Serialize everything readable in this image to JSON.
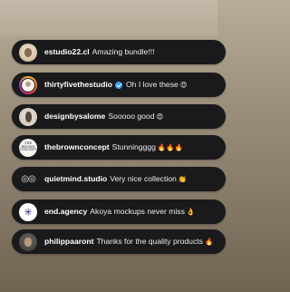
{
  "comments": [
    {
      "user": "estudio22.cl",
      "verified": false,
      "message": "Amazing bundle!!!",
      "emoji": "",
      "avatar_icon": "portrait-avatar"
    },
    {
      "user": "thirtyfivethestudio",
      "verified": true,
      "message": "Oh I love these",
      "emoji": "😍",
      "avatar_icon": "star-logo-avatar"
    },
    {
      "user": "designbysalome",
      "verified": false,
      "message": "Sooooo good",
      "emoji": "😍",
      "avatar_icon": "portrait-avatar"
    },
    {
      "user": "thebrownconcept",
      "verified": false,
      "message": "Stunningggg",
      "emoji": "🔥🔥🔥",
      "avatar_icon": "wordmark-logo-avatar"
    },
    {
      "user": "quietmind.studio",
      "verified": false,
      "message": "Very nice collection",
      "emoji": "👏",
      "avatar_icon": "rings-logo-avatar"
    },
    {
      "user": "end.agency",
      "verified": false,
      "message": "Akoya mockups never miss",
      "emoji": "👌",
      "avatar_icon": "burst-logo-avatar"
    },
    {
      "user": "philippaaront",
      "verified": false,
      "message": "Thanks for the quality products",
      "emoji": "🔥",
      "avatar_icon": "portrait-avatar"
    }
  ],
  "colors": {
    "bubble": "#1a1a1c",
    "verified": "#3b9cf5",
    "text": "#f2f2f2"
  }
}
